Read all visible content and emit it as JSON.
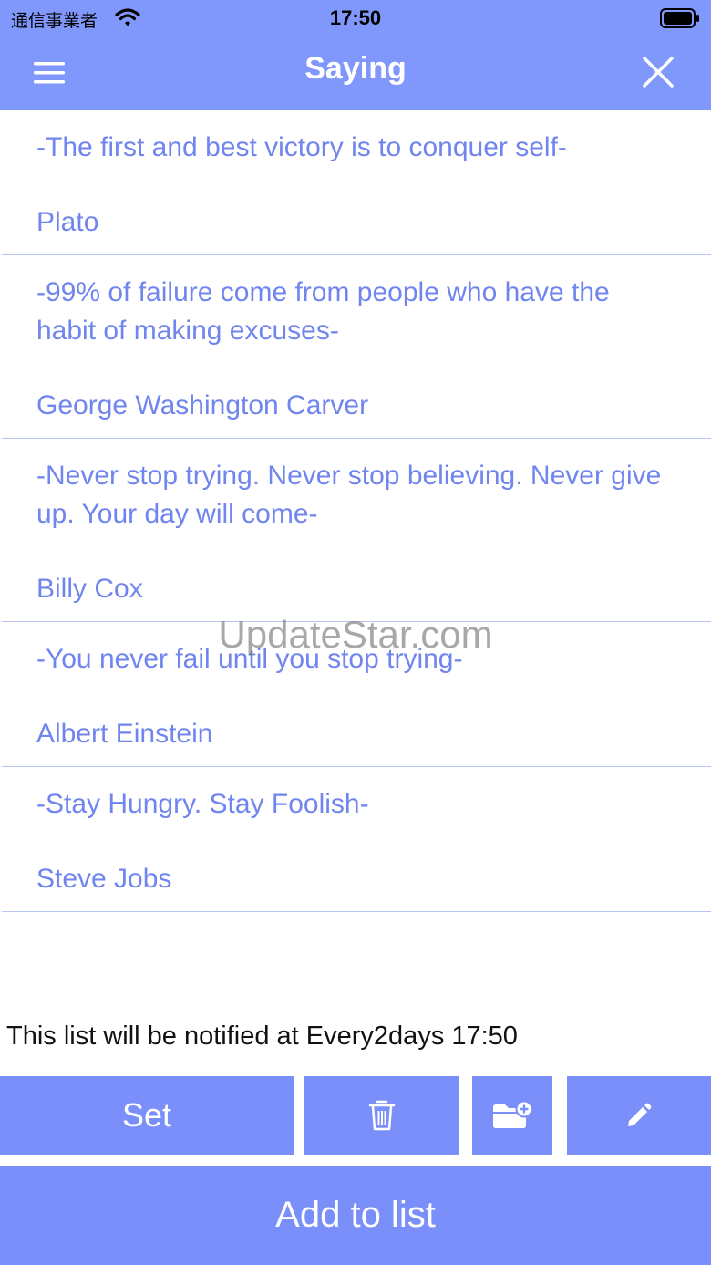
{
  "status": {
    "carrier": "通信事業者",
    "time": "17:50"
  },
  "nav": {
    "title": "Saying"
  },
  "quotes": [
    {
      "text": "-The first and best victory is to conquer self-",
      "author": "Plato"
    },
    {
      "text": "-99% of failure come from people who have the habit of making excuses-",
      "author": "George Washington Carver"
    },
    {
      "text": "-Never stop trying. Never stop believing. Never give up. Your day will come-",
      "author": "Billy Cox"
    },
    {
      "text": "-You never fail until you stop trying-",
      "author": "Albert Einstein"
    },
    {
      "text": "-Stay Hungry. Stay Foolish-",
      "author": "Steve Jobs"
    }
  ],
  "watermark": "UpdateStar.com",
  "notification": {
    "text": "This list will be notified at Every2days 17:50"
  },
  "toolbar": {
    "set_label": "Set",
    "icons": [
      "trash-icon",
      "folder-add-icon",
      "pencil-icon"
    ]
  },
  "add_button": {
    "label": "Add to list"
  },
  "colors": {
    "accent": "#7b8ffb",
    "header": "#8097fb",
    "quote_text": "#7085ee",
    "divider": "#b9c4f3"
  }
}
